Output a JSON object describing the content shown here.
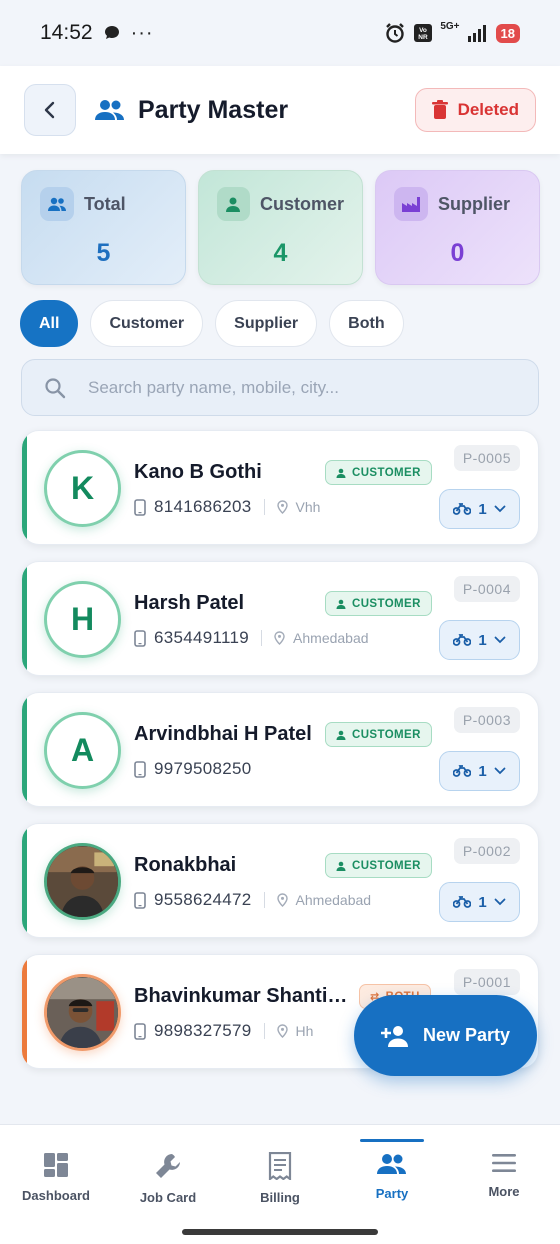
{
  "status_bar": {
    "time": "14:52",
    "network": "5G+",
    "battery": "18"
  },
  "header": {
    "title": "Party Master",
    "deleted_label": "Deleted"
  },
  "stats": {
    "total": {
      "label": "Total",
      "value": "5"
    },
    "customer": {
      "label": "Customer",
      "value": "4"
    },
    "supplier": {
      "label": "Supplier",
      "value": "0"
    }
  },
  "filters": [
    "All",
    "Customer",
    "Supplier",
    "Both"
  ],
  "active_filter": "All",
  "search": {
    "placeholder": "Search party name, mobile, city..."
  },
  "parties": [
    {
      "initial": "K",
      "name": "Kano B Gothi",
      "phone": "8141686203",
      "city": "Vhh",
      "type": "CUSTOMER",
      "id": "P-0005",
      "vehicles": "1"
    },
    {
      "initial": "H",
      "name": "Harsh Patel",
      "phone": "6354491119",
      "city": "Ahmedabad",
      "type": "CUSTOMER",
      "id": "P-0004",
      "vehicles": "1"
    },
    {
      "initial": "A",
      "name": "Arvindbhai H Patel",
      "phone": "9979508250",
      "city": "",
      "type": "CUSTOMER",
      "id": "P-0003",
      "vehicles": "1"
    },
    {
      "initial": "",
      "name": "Ronakbhai",
      "phone": "9558624472",
      "city": "Ahmedabad",
      "type": "CUSTOMER",
      "id": "P-0002",
      "vehicles": "1"
    },
    {
      "initial": "",
      "name": "Bhavinkumar Shantil...",
      "phone": "9898327579",
      "city": "Hh",
      "type": "BOTH",
      "id": "P-0001",
      "vehicles": ""
    }
  ],
  "fab": {
    "label": "New Party"
  },
  "nav": {
    "items": [
      {
        "label": "Dashboard",
        "icon": "dashboard-icon"
      },
      {
        "label": "Job Card",
        "icon": "wrench-icon"
      },
      {
        "label": "Billing",
        "icon": "receipt-icon"
      },
      {
        "label": "Party",
        "icon": "people-icon"
      },
      {
        "label": "More",
        "icon": "menu-icon"
      }
    ],
    "active": "Party"
  },
  "colors": {
    "primary": "#1770c2",
    "customer_green": "#1b8e62",
    "both_orange": "#e0743a",
    "deleted_red": "#d93434",
    "supplier_purple": "#7a3fd4"
  }
}
